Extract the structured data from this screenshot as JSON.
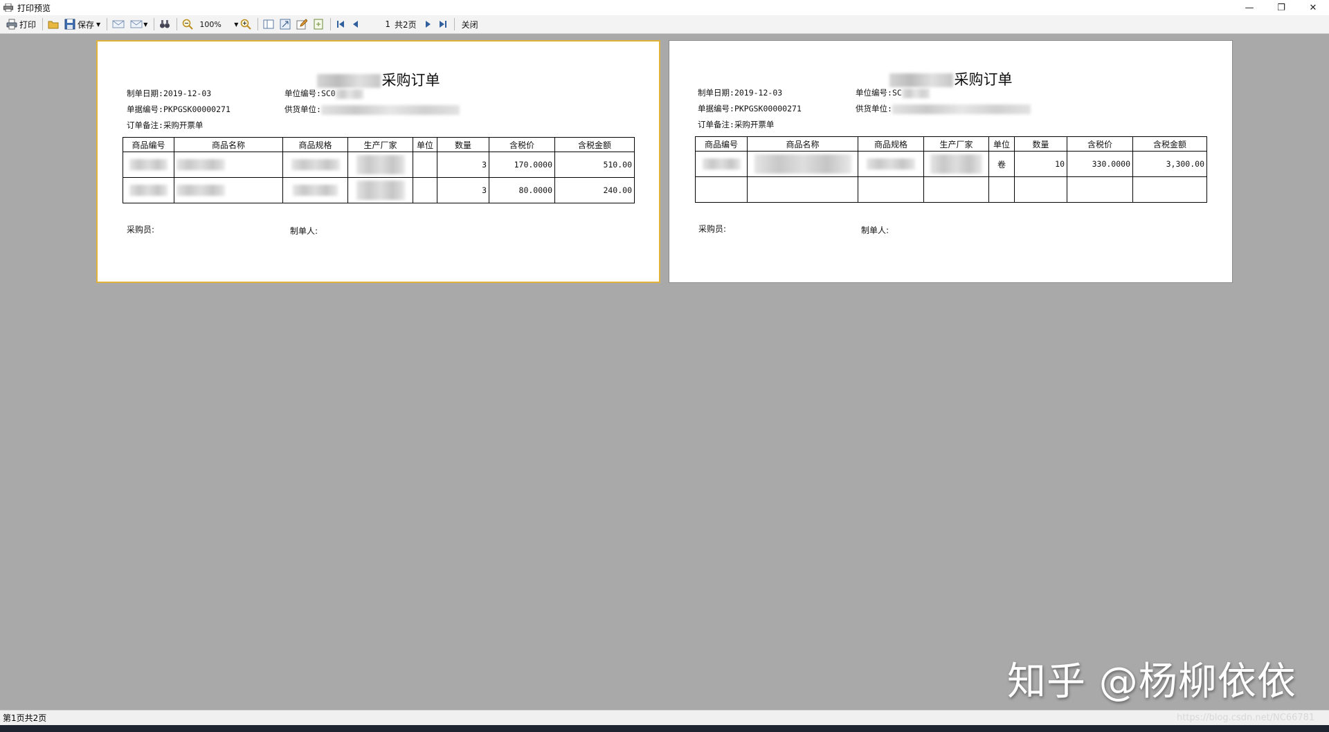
{
  "window": {
    "title": "打印预览"
  },
  "toolbar": {
    "print_label": "打印",
    "save_label": "保存",
    "zoom": "100%",
    "page_current": "1",
    "page_total_text": "共2页",
    "close_label": "关闭"
  },
  "pages": [
    {
      "title_suffix": "采购订单",
      "date_label": "制单日期:",
      "date_value": "2019-12-03",
      "unit_code_label": "单位编号:",
      "unit_code_value": "SC0",
      "doc_no_label": "单据编号:",
      "doc_no_value": "PKPGSK00000271",
      "supplier_label": "供货单位:",
      "remark_label": "订单备注:",
      "remark_value": "采购开票单",
      "buyer_label": "采购员:",
      "maker_label": "制单人:",
      "rows": [
        {
          "unit": "",
          "qty": "3",
          "price": "170.0000",
          "amount": "510.00"
        },
        {
          "unit": "",
          "qty": "3",
          "price": "80.0000",
          "amount": "240.00"
        }
      ]
    },
    {
      "title_suffix": "采购订单",
      "date_label": "制单日期:",
      "date_value": "2019-12-03",
      "unit_code_label": "单位编号:",
      "unit_code_value": "SC",
      "doc_no_label": "单据编号:",
      "doc_no_value": "PKPGSK00000271",
      "supplier_label": "供货单位:",
      "remark_label": "订单备注:",
      "remark_value": "采购开票单",
      "buyer_label": "采购员:",
      "maker_label": "制单人:",
      "rows": [
        {
          "unit": "卷",
          "qty": "10",
          "price": "330.0000",
          "amount": "3,300.00"
        },
        {
          "unit": "",
          "qty": "",
          "price": "",
          "amount": ""
        }
      ]
    }
  ],
  "table_headers": [
    "商品编号",
    "商品名称",
    "商品规格",
    "生产厂家",
    "单位",
    "数量",
    "含税价",
    "含税金额"
  ],
  "status": {
    "text": "第1页共2页"
  },
  "watermark": {
    "text": "知乎 @杨柳依依",
    "url": "https://blog.csdn.net/NC66781"
  }
}
